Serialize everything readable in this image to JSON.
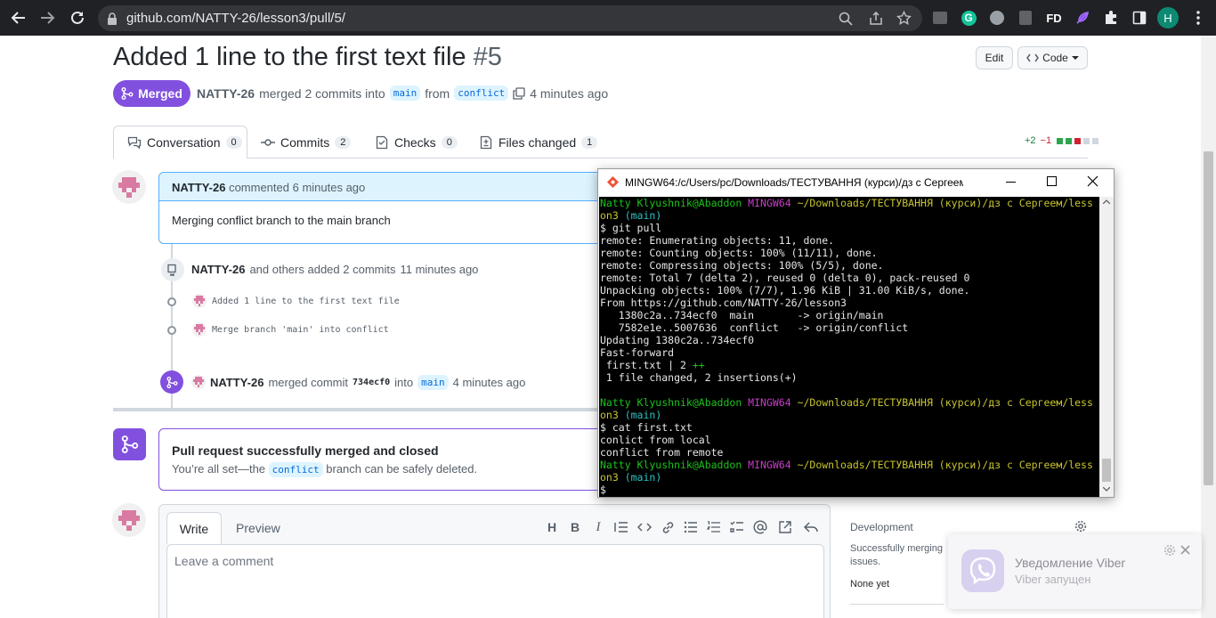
{
  "browser": {
    "url": "github.com/NATTY-26/lesson3/pull/5/",
    "profile_initial": "H",
    "extension_fd": "FD"
  },
  "pr": {
    "title": "Added 1 line to the first text file",
    "number": "#5",
    "state": "Merged",
    "author": "NATTY-26",
    "merged_text": "merged 2 commits into",
    "base_branch": "main",
    "from_text": "from",
    "head_branch": "conflict",
    "time": "4 minutes ago",
    "edit_label": "Edit",
    "code_label": "Code"
  },
  "tabs": [
    {
      "label": "Conversation",
      "count": "0"
    },
    {
      "label": "Commits",
      "count": "2"
    },
    {
      "label": "Checks",
      "count": "0"
    },
    {
      "label": "Files changed",
      "count": "1"
    }
  ],
  "diffstat": {
    "add": "+2",
    "del": "−1"
  },
  "comment": {
    "author": "NATTY-26",
    "action": "commented",
    "time": "6 minutes ago",
    "body": "Merging conflict branch to the main branch"
  },
  "commits_event": {
    "author": "NATTY-26",
    "text": "and others added 2 commits",
    "time": "11 minutes ago",
    "commits": [
      "Added 1 line to the first text file",
      "Merge branch 'main' into conflict"
    ]
  },
  "merge_event": {
    "author": "NATTY-26",
    "text": "merged commit",
    "sha": "734ecf0",
    "into": "into",
    "branch": "main",
    "time": "4 minutes ago"
  },
  "merged_box": {
    "title": "Pull request successfully merged and closed",
    "sub_pre": "You’re all set—the",
    "branch": "conflict",
    "sub_post": "branch can be safely deleted."
  },
  "editor": {
    "write": "Write",
    "preview": "Preview",
    "placeholder": "Leave a comment",
    "toolbar_icons": [
      "heading-icon",
      "bold-icon",
      "italic-icon",
      "quote-icon",
      "code-icon",
      "link-icon",
      "unordered-list-icon",
      "ordered-list-icon",
      "task-list-icon",
      "mention-icon",
      "reference-icon",
      "reply-icon"
    ]
  },
  "sidebar": {
    "development": "Development",
    "dev_text": "Successfully merging this pull request may close these issues.",
    "dev_text_visible": "Successfully merging",
    "dev_text_visible2": "issues.",
    "none_yet": "None yet"
  },
  "terminal": {
    "title": "MINGW64:/c/Users/pc/Downloads/ТЕСТУВАННЯ (курси)/дз с Сергеем/les...",
    "lines": [
      [
        [
          "Natty Klyushnik@Abaddon ",
          "g"
        ],
        [
          "MINGW64 ",
          "m"
        ],
        [
          "~/Downloads/ТЕСТУВАННЯ (курси)/дз с Сергеем/less",
          "y"
        ]
      ],
      [
        [
          "on3 ",
          "y"
        ],
        [
          "(main)",
          "c"
        ]
      ],
      [
        [
          "$ git pull",
          ""
        ]
      ],
      [
        [
          "remote: Enumerating objects: 11, done.",
          ""
        ]
      ],
      [
        [
          "remote: Counting objects: 100% (11/11), done.",
          ""
        ]
      ],
      [
        [
          "remote: Compressing objects: 100% (5/5), done.",
          ""
        ]
      ],
      [
        [
          "remote: Total 7 (delta 2), reused 0 (delta 0), pack-reused 0",
          ""
        ]
      ],
      [
        [
          "Unpacking objects: 100% (7/7), 1.96 KiB | 31.00 KiB/s, done.",
          ""
        ]
      ],
      [
        [
          "From https://github.com/NATTY-26/lesson3",
          ""
        ]
      ],
      [
        [
          "   1380c2a..734ecf0  main       -> origin/main",
          ""
        ]
      ],
      [
        [
          "   7582e1e..5007636  conflict   -> origin/conflict",
          ""
        ]
      ],
      [
        [
          "Updating 1380c2a..734ecf0",
          ""
        ]
      ],
      [
        [
          "Fast-forward",
          ""
        ]
      ],
      [
        [
          " first.txt | 2 ",
          ""
        ],
        [
          "++",
          "g"
        ]
      ],
      [
        [
          " 1 file changed, 2 insertions(+)",
          ""
        ]
      ],
      [
        [
          "",
          ""
        ]
      ],
      [
        [
          "Natty Klyushnik@Abaddon ",
          "g"
        ],
        [
          "MINGW64 ",
          "m"
        ],
        [
          "~/Downloads/ТЕСТУВАННЯ (курси)/дз с Сергеем/less",
          "y"
        ]
      ],
      [
        [
          "on3 ",
          "y"
        ],
        [
          "(main)",
          "c"
        ]
      ],
      [
        [
          "$ cat first.txt",
          ""
        ]
      ],
      [
        [
          "conlict from local",
          ""
        ]
      ],
      [
        [
          "conflict from remote",
          ""
        ]
      ],
      [
        [
          "Natty Klyushnik@Abaddon ",
          "g"
        ],
        [
          "MINGW64 ",
          "m"
        ],
        [
          "~/Downloads/ТЕСТУВАННЯ (курси)/дз с Сергеем/less",
          "y"
        ]
      ],
      [
        [
          "on3 ",
          "y"
        ],
        [
          "(main)",
          "c"
        ]
      ],
      [
        [
          "$",
          ""
        ]
      ]
    ]
  },
  "viber": {
    "title": "Уведомление Viber",
    "subtitle": "Viber запущен"
  },
  "colors": {
    "accent_merged": "#8250df",
    "link": "#0969da"
  }
}
